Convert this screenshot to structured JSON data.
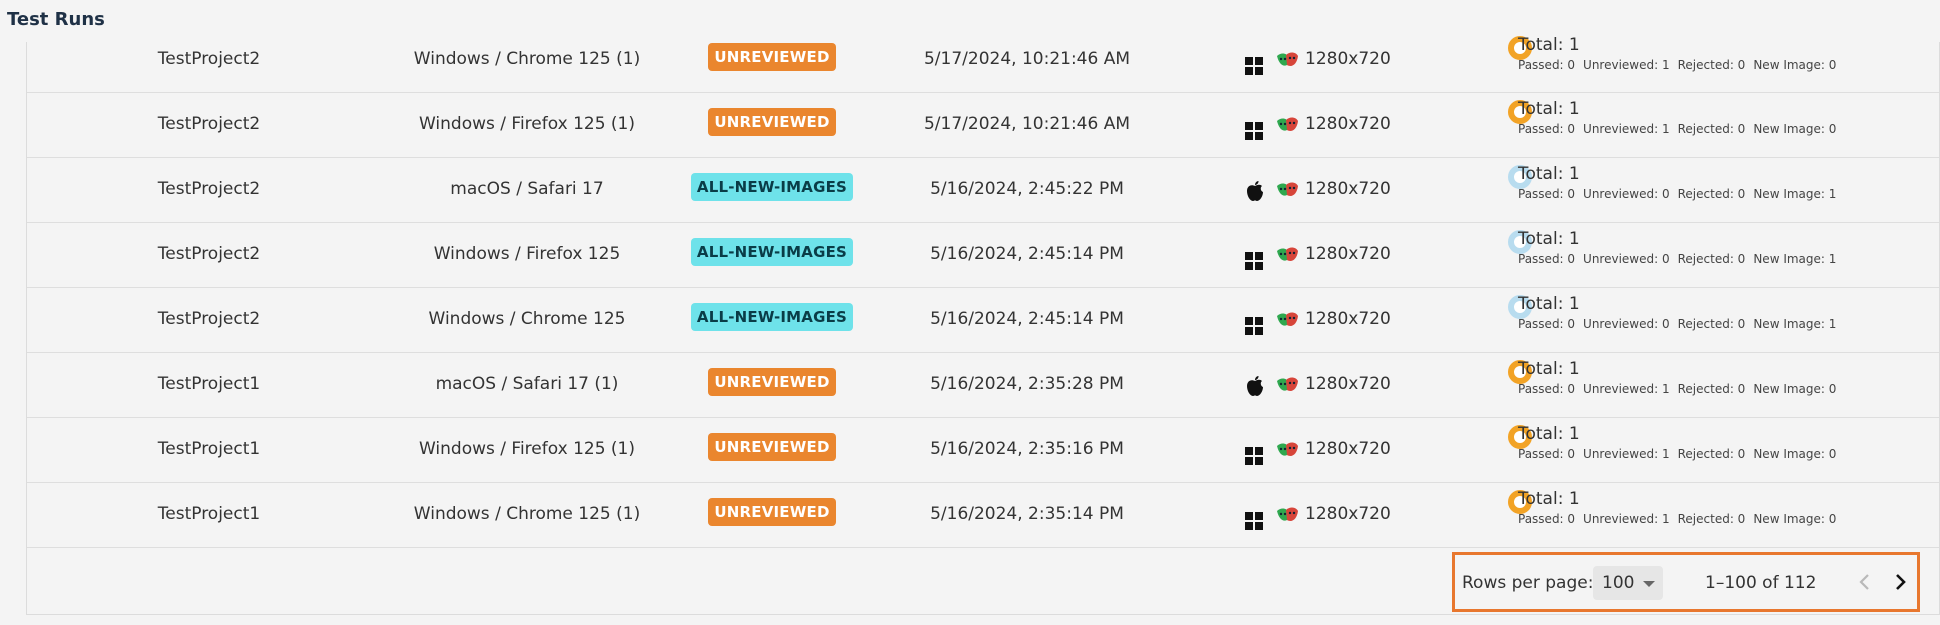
{
  "page": {
    "title": "Test Runs"
  },
  "table": {
    "rows": [
      {
        "project": "TestProject2",
        "browser": "Windows / Chrome 125 (1)",
        "status": "UNREVIEWED",
        "status_kind": "unreviewed",
        "date": "5/17/2024, 10:21:46 AM",
        "os_icon": "windows-icon",
        "app_icon": "playwright-icon",
        "viewport": "1280x720",
        "donut": "orange",
        "total": "Total: 1",
        "passed": "Passed: 0",
        "unreviewed": "Unreviewed: 1",
        "rejected": "Rejected: 0",
        "new_image": "New Image: 0"
      },
      {
        "project": "TestProject2",
        "browser": "Windows / Firefox 125 (1)",
        "status": "UNREVIEWED",
        "status_kind": "unreviewed",
        "date": "5/17/2024, 10:21:46 AM",
        "os_icon": "windows-icon",
        "app_icon": "playwright-icon",
        "viewport": "1280x720",
        "donut": "orange",
        "total": "Total: 1",
        "passed": "Passed: 0",
        "unreviewed": "Unreviewed: 1",
        "rejected": "Rejected: 0",
        "new_image": "New Image: 0"
      },
      {
        "project": "TestProject2",
        "browser": "macOS / Safari 17",
        "status": "ALL-NEW-IMAGES",
        "status_kind": "new",
        "date": "5/16/2024, 2:45:22 PM",
        "os_icon": "apple-icon",
        "app_icon": "playwright-icon",
        "viewport": "1280x720",
        "donut": "blue",
        "total": "Total: 1",
        "passed": "Passed: 0",
        "unreviewed": "Unreviewed: 0",
        "rejected": "Rejected: 0",
        "new_image": "New Image: 1"
      },
      {
        "project": "TestProject2",
        "browser": "Windows / Firefox 125",
        "status": "ALL-NEW-IMAGES",
        "status_kind": "new",
        "date": "5/16/2024, 2:45:14 PM",
        "os_icon": "windows-icon",
        "app_icon": "playwright-icon",
        "viewport": "1280x720",
        "donut": "blue",
        "total": "Total: 1",
        "passed": "Passed: 0",
        "unreviewed": "Unreviewed: 0",
        "rejected": "Rejected: 0",
        "new_image": "New Image: 1"
      },
      {
        "project": "TestProject2",
        "browser": "Windows / Chrome 125",
        "status": "ALL-NEW-IMAGES",
        "status_kind": "new",
        "date": "5/16/2024, 2:45:14 PM",
        "os_icon": "windows-icon",
        "app_icon": "playwright-icon",
        "viewport": "1280x720",
        "donut": "blue",
        "total": "Total: 1",
        "passed": "Passed: 0",
        "unreviewed": "Unreviewed: 0",
        "rejected": "Rejected: 0",
        "new_image": "New Image: 1"
      },
      {
        "project": "TestProject1",
        "browser": "macOS / Safari 17 (1)",
        "status": "UNREVIEWED",
        "status_kind": "unreviewed",
        "date": "5/16/2024, 2:35:28 PM",
        "os_icon": "apple-icon",
        "app_icon": "playwright-icon",
        "viewport": "1280x720",
        "donut": "orange",
        "total": "Total: 1",
        "passed": "Passed: 0",
        "unreviewed": "Unreviewed: 1",
        "rejected": "Rejected: 0",
        "new_image": "New Image: 0"
      },
      {
        "project": "TestProject1",
        "browser": "Windows / Firefox 125 (1)",
        "status": "UNREVIEWED",
        "status_kind": "unreviewed",
        "date": "5/16/2024, 2:35:16 PM",
        "os_icon": "windows-icon",
        "app_icon": "playwright-icon",
        "viewport": "1280x720",
        "donut": "orange",
        "total": "Total: 1",
        "passed": "Passed: 0",
        "unreviewed": "Unreviewed: 1",
        "rejected": "Rejected: 0",
        "new_image": "New Image: 0"
      },
      {
        "project": "TestProject1",
        "browser": "Windows / Chrome 125 (1)",
        "status": "UNREVIEWED",
        "status_kind": "unreviewed",
        "date": "5/16/2024, 2:35:14 PM",
        "os_icon": "windows-icon",
        "app_icon": "playwright-icon",
        "viewport": "1280x720",
        "donut": "orange",
        "total": "Total: 1",
        "passed": "Passed: 0",
        "unreviewed": "Unreviewed: 1",
        "rejected": "Rejected: 0",
        "new_image": "New Image: 0"
      }
    ]
  },
  "pagination": {
    "rows_per_page_label": "Rows per page:",
    "rows_per_page_value": "100",
    "range": "1–100 of 112",
    "prev_icon": "chevron-left-icon",
    "next_icon": "chevron-right-icon"
  },
  "colors": {
    "unreviewed": "#ea862e",
    "new_images": "#6ee2ea",
    "donut_orange": "#f2a326",
    "donut_blue": "#b8dcef",
    "pager_highlight": "#e8772e"
  }
}
